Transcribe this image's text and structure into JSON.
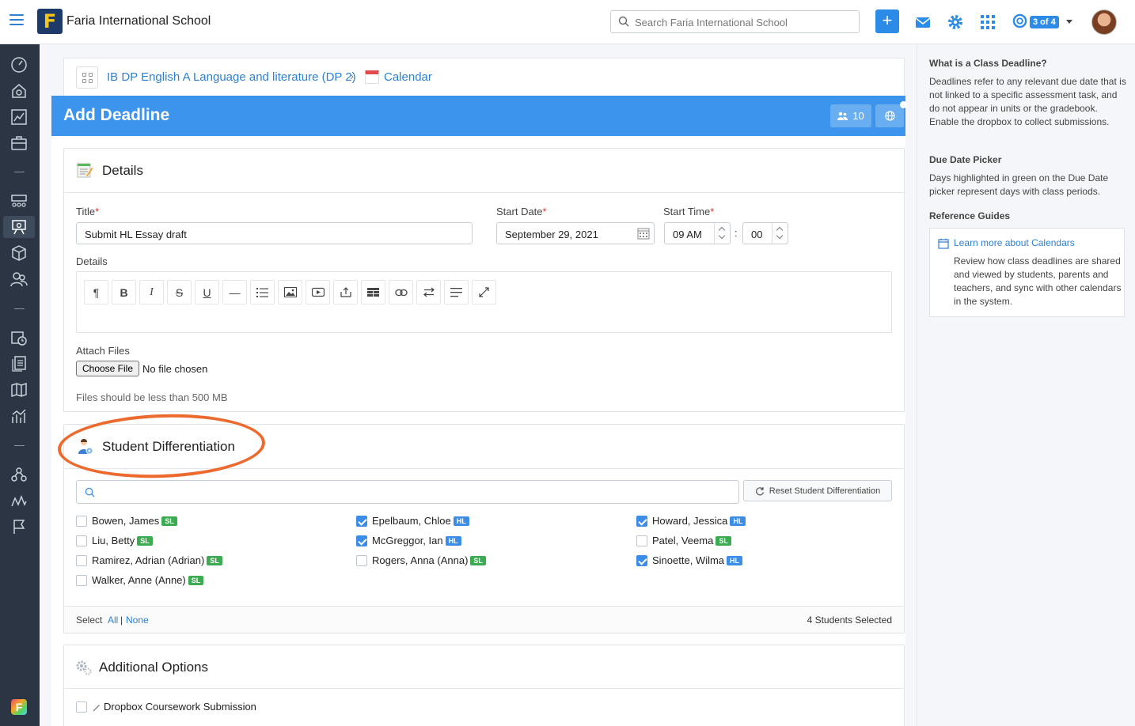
{
  "topbar": {
    "school_name": "Faria International School",
    "logo_letter": "F",
    "search_placeholder": "Search Faria International School",
    "plus_label": "+",
    "pager_label": "3 of 4",
    "icons": [
      "menu-icon",
      "mail-icon",
      "gear-icon",
      "apps-grid-icon",
      "help-lifebuoy-icon"
    ]
  },
  "sidebar": {
    "icons": [
      "dashboard-icon",
      "home-icon",
      "chart-icon",
      "briefcase-icon",
      "classes-icon",
      "teaching-icon",
      "cube-icon",
      "people-icon",
      "calendar-clock-icon",
      "documents-icon",
      "map-icon",
      "analytics-icon",
      "network-icon",
      "signal-icon",
      "flag-icon"
    ]
  },
  "breadcrumb": {
    "course": "IB DP English A Language and literature (DP 2)",
    "separator": "›",
    "calendar": "Calendar"
  },
  "header": {
    "title": "Add Deadline",
    "student_count": "10"
  },
  "details": {
    "section_title": "Details",
    "title_label": "Title",
    "title_value": "Submit HL Essay draft",
    "start_date_label": "Start Date",
    "start_date_value": "September 29, 2021",
    "start_time_label": "Start Time",
    "hour_value": "09 AM",
    "time_sep": ":",
    "minute_value": "00",
    "details_label": "Details",
    "required_mark": "*",
    "toolbar": [
      "¶",
      "B",
      "I",
      "S",
      "U",
      "—",
      "list",
      "image",
      "video",
      "embed",
      "table",
      "link",
      "ltr",
      "align",
      "fullscreen"
    ],
    "attach_label": "Attach Files",
    "choose_file": "Choose File",
    "no_file": "No file chosen",
    "size_note": "Files should be less than 500 MB"
  },
  "differentiation": {
    "section_title": "Student Differentiation",
    "reset_label": "Reset Student Differentiation",
    "students": [
      {
        "name": "Bowen, James",
        "level": "SL",
        "checked": false
      },
      {
        "name": "Liu, Betty",
        "level": "SL",
        "checked": false
      },
      {
        "name": "Ramirez, Adrian (Adrian)",
        "level": "SL",
        "checked": false
      },
      {
        "name": "Walker, Anne (Anne)",
        "level": "SL",
        "checked": false
      },
      {
        "name": "Epelbaum, Chloe",
        "level": "HL",
        "checked": true
      },
      {
        "name": "McGreggor, Ian",
        "level": "HL",
        "checked": true
      },
      {
        "name": "Rogers, Anna (Anna)",
        "level": "SL",
        "checked": false
      },
      {
        "name": "Howard, Jessica",
        "level": "HL",
        "checked": true
      },
      {
        "name": "Patel, Veema",
        "level": "SL",
        "checked": false
      },
      {
        "name": "Sinoette, Wilma",
        "level": "HL",
        "checked": true
      }
    ],
    "select_label": "Select",
    "all_label": "All",
    "pipe": "|",
    "none_label": "None",
    "selected_count": "4 Students Selected"
  },
  "additional": {
    "section_title": "Additional Options",
    "dropbox_label": "Dropbox Coursework Submission"
  },
  "right_panel": {
    "h1": "What is a Class Deadline?",
    "p1": "Deadlines refer to any relevant due date that is not linked to a specific assessment task, and do not appear in units or the gradebook. Enable the dropbox to collect submissions.",
    "h2": "Due Date Picker",
    "p2": "Days highlighted in green on the Due Date picker represent days with class periods.",
    "h3": "Reference Guides",
    "guide_link": "Learn more about Calendars",
    "guide_text": "Review how class deadlines are shared and viewed by students, parents and teachers, and sync with other calendars in the system."
  },
  "colors": {
    "header_blue": "#3c94ec",
    "link_blue": "#2f80d1",
    "sidebar_bg": "#2b3543",
    "annotation_orange": "#ec6a2d",
    "sl_green": "#3cab52",
    "hl_blue": "#3c8de8"
  }
}
